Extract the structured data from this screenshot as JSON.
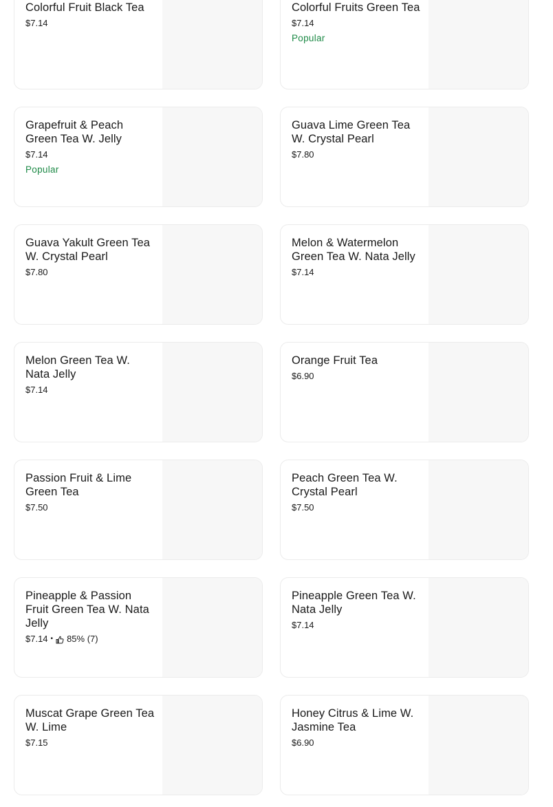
{
  "items": [
    {
      "name": "Colorful Fruit Black Tea",
      "price": "$7.14",
      "popular": ""
    },
    {
      "name": "Colorful Fruits Green Tea",
      "price": "$7.14",
      "popular": "Popular"
    },
    {
      "name": "Grapefruit & Peach Green Tea W. Jelly",
      "price": "$7.14",
      "popular": "Popular"
    },
    {
      "name": "Guava Lime Green Tea W. Crystal Pearl",
      "price": "$7.80",
      "popular": ""
    },
    {
      "name": "Guava Yakult Green Tea W. Crystal Pearl",
      "price": "$7.80",
      "popular": ""
    },
    {
      "name": "Melon & Watermelon Green Tea W. Nata Jelly",
      "price": "$7.14",
      "popular": ""
    },
    {
      "name": "Melon Green Tea W. Nata Jelly",
      "price": "$7.14",
      "popular": ""
    },
    {
      "name": "Orange Fruit Tea",
      "price": "$6.90",
      "popular": ""
    },
    {
      "name": "Passion Fruit & Lime Green Tea",
      "price": "$7.50",
      "popular": ""
    },
    {
      "name": "Peach Green Tea W. Crystal Pearl",
      "price": "$7.50",
      "popular": ""
    },
    {
      "name": "Pineapple & Passion Fruit Green Tea W. Nata Jelly",
      "price": "$7.14",
      "popular": "",
      "separator": "•",
      "rating": "85% (7)",
      "rating_icon": "thumbs-up-icon"
    },
    {
      "name": "Pineapple Green Tea W. Nata Jelly",
      "price": "$7.14",
      "popular": ""
    },
    {
      "name": "Muscat Grape Green Tea W. Lime",
      "price": "$7.15",
      "popular": ""
    },
    {
      "name": "Honey Citrus & Lime W. Jasmine Tea",
      "price": "$6.90",
      "popular": ""
    }
  ],
  "colors": {
    "popular": "#1e8a47",
    "thumbnail_placeholder": "#f7f7f7",
    "card_border": "#ebebeb"
  }
}
